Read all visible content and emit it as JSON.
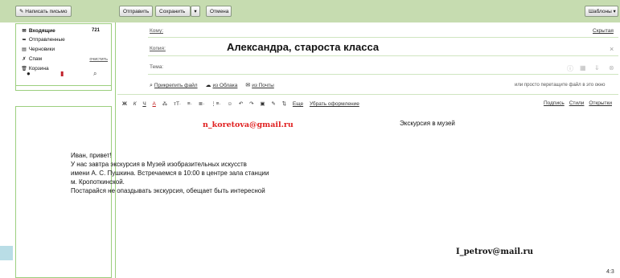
{
  "toolbar": {
    "compose_label": "Написать письмо",
    "send_label": "Отправить",
    "save_label": "Сохранить",
    "save_arrow": "▾",
    "cancel_label": "Отмена",
    "templates_label": "Шаблоны ▾"
  },
  "sidebar": {
    "folders": [
      {
        "icon": "inbox-icon",
        "glyph": "✉",
        "label": "Входящие",
        "count": "721",
        "bold": true
      },
      {
        "icon": "sent-icon",
        "glyph": "➥",
        "label": "Отправленные"
      },
      {
        "icon": "drafts-icon",
        "glyph": "▤",
        "label": "Черновики"
      },
      {
        "icon": "spam-icon",
        "glyph": "✗",
        "label": "Спам",
        "action": "очистить"
      },
      {
        "icon": "trash-icon",
        "glyph": "🗑",
        "label": "Корзина"
      }
    ],
    "bottom_icons": [
      {
        "name": "unread-dot-icon",
        "glyph": "●",
        "color": "#222222"
      },
      {
        "name": "bookmark-icon",
        "glyph": "▮",
        "color": "#c0202a"
      },
      {
        "name": "attachment-clip-icon",
        "glyph": "⌕",
        "color": "#444444"
      }
    ]
  },
  "compose": {
    "to_label": "Кому:",
    "cc_label": "Копия:",
    "subject_label": "Тема:",
    "hidden_copy": "Скрытая",
    "close_glyph": "×",
    "to_value": "Александра, староста класса",
    "attach_file": "Прикрепить файл",
    "from_cloud": "из Облака",
    "from_mail": "из Почты",
    "drag_hint": "или просто перетащите файл в это окно",
    "format_tools": [
      "Ж",
      "К",
      "Ч",
      "А",
      "⁂",
      "тТ·",
      "≡·",
      "≣·",
      "⋮≡·",
      "☺",
      "↶",
      "↷",
      "▣",
      "✎",
      "⇅"
    ],
    "translit": "Еще",
    "clear_format": "Убрать оформление",
    "signature_link": "Подпись",
    "styles_link": "Стили",
    "cards_link": "Открытки",
    "subject_icons": [
      "ⓘ",
      "▦",
      "⇓",
      "⊗"
    ]
  },
  "body": {
    "red_email": "n_koretova@gmail.ru",
    "title": "Экскурсия в музей",
    "lines": [
      "Иван, привет!",
      "У нас завтра экскурсия в Музей изобразительных искусств",
      "имени А. С. Пушкина. Встречаемся в 10:00 в центре зала станции",
      "м. Кропоткинской.",
      "Постарайся не опаздывать экскурсия, обещает быть интересной"
    ],
    "signature_email": "I_petrov@mail.ru",
    "aspect_ratio": "4:3"
  },
  "colors": {
    "topbar": "#c6dcb0",
    "panel_border": "#9ccf7e",
    "red_email": "#e02020"
  }
}
